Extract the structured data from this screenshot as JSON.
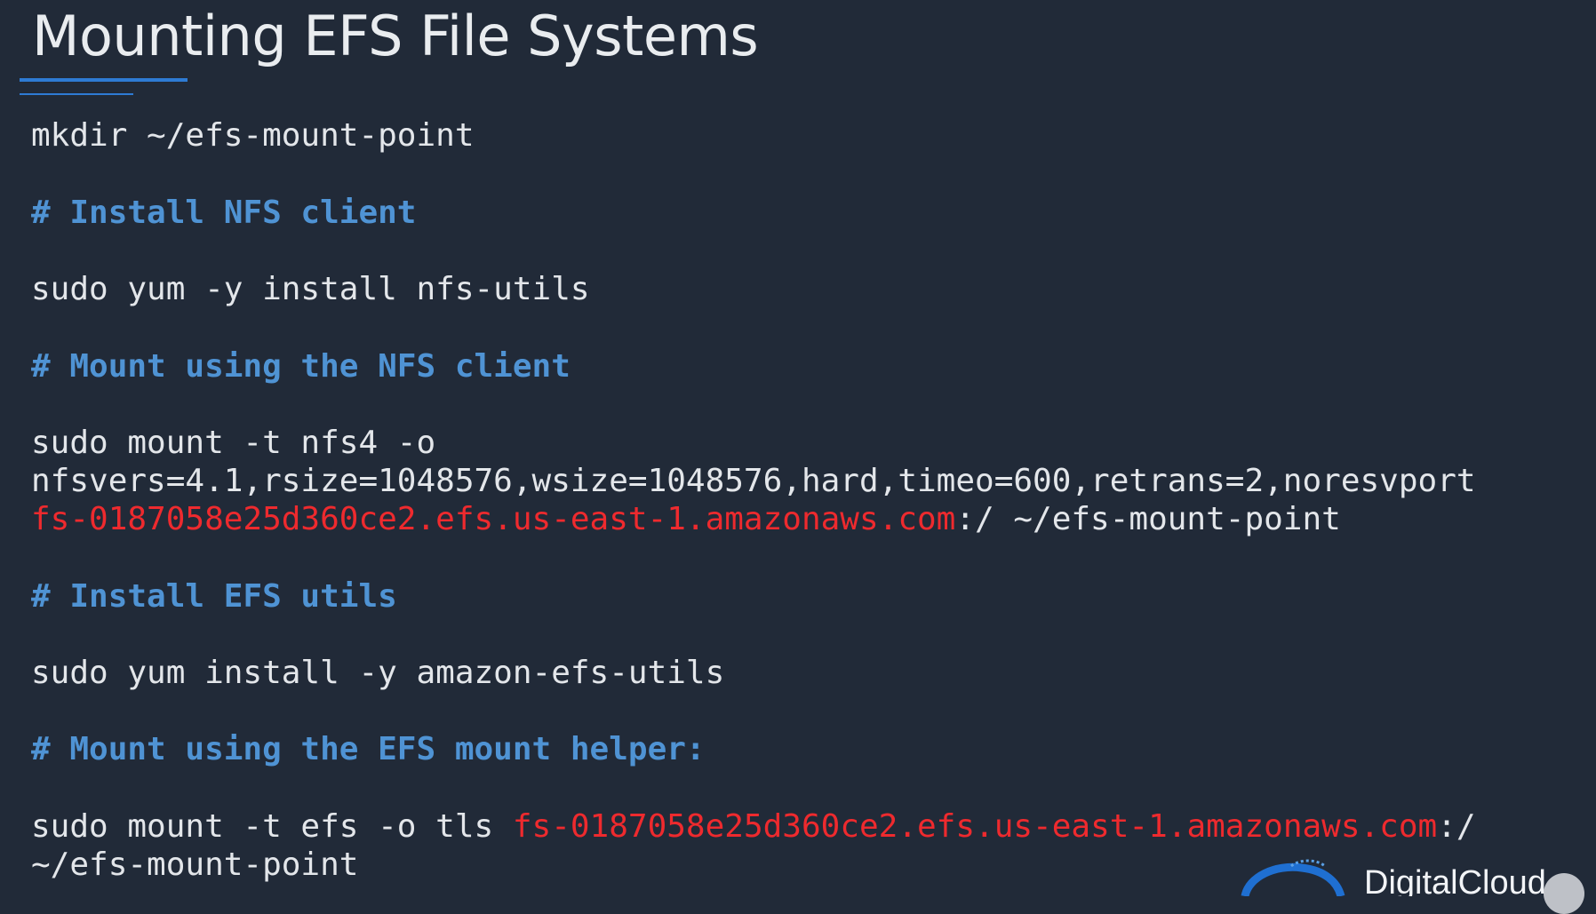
{
  "slide": {
    "title": "Mounting EFS File Systems"
  },
  "code": {
    "line_mkdir": "mkdir ~/efs-mount-point",
    "comment_install_nfs": "# Install NFS client",
    "line_yum_nfs": "sudo yum -y install nfs-utils",
    "comment_mount_nfs": "# Mount using the NFS client",
    "line_mount_nfs_1": "sudo mount -t nfs4 -o",
    "line_mount_nfs_2": "nfsvers=4.1,rsize=1048576,wsize=1048576,hard,timeo=600,retrans=2,noresvport",
    "line_mount_nfs_3_host": "fs-0187058e25d360ce2.efs.us-east-1.amazonaws.com",
    "line_mount_nfs_3_rest": ":/ ~/efs-mount-point",
    "comment_install_efs": "# Install EFS utils",
    "line_yum_efs": "sudo yum install -y amazon-efs-utils",
    "comment_mount_efs": "# Mount using the EFS mount helper:",
    "line_mount_efs_1_prefix": "sudo mount -t efs -o tls ",
    "line_mount_efs_1_host": "fs-0187058e25d360ce2.efs.us-east-1.amazonaws.com",
    "line_mount_efs_1_suffix": ":/",
    "line_mount_efs_2": "~/efs-mount-point"
  },
  "branding": {
    "logo_text": "DigitalCloud"
  },
  "colors": {
    "background": "#212a38",
    "command_text": "#e3e6ea",
    "comment_text": "#4f93d4",
    "highlight_red": "#ee2a2e",
    "accent_blue": "#2e7bd4"
  }
}
